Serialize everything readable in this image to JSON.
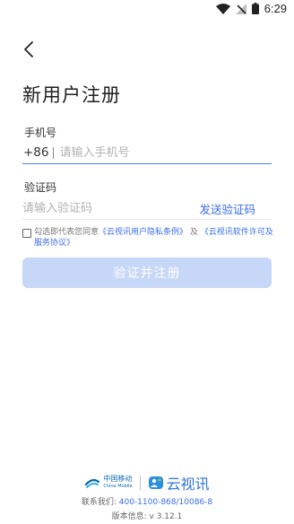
{
  "status_bar": {
    "time": "6:29"
  },
  "page": {
    "title": "新用户注册"
  },
  "phone": {
    "label": "手机号",
    "country_code": "+86",
    "placeholder": "请输入手机号",
    "value": ""
  },
  "code": {
    "label": "验证码",
    "placeholder": "请输入验证码",
    "value": "",
    "send_label": "发送验证码"
  },
  "agreement": {
    "text": "勾选即代表您同意",
    "link1": "《云视讯用户隐私条例》",
    "and": "及",
    "link2": "《云视讯软件许可及服务协议》"
  },
  "submit_label": "验证并注册",
  "footer": {
    "cm_cn": "中国移动",
    "cm_en": "China Mobile",
    "product": "云视讯",
    "contact_label": "联系我们:",
    "contact_numbers": "400-1100-868/10086-8",
    "version": "版本信息: v 3.12.1"
  },
  "colors": {
    "accent": "#3a6ee8",
    "button_disabled": "#c7d7f8",
    "link": "#3a6ee8"
  }
}
